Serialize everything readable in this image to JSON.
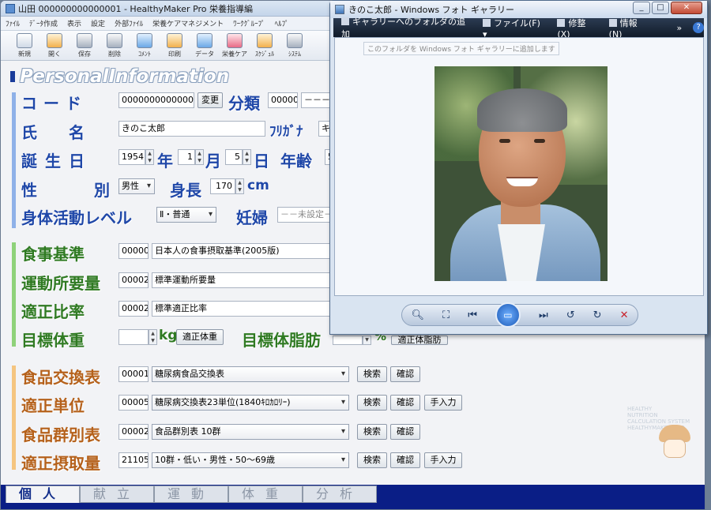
{
  "app": {
    "title": "山田 000000000000001 - HealthyMaker Pro 栄養指導編",
    "menu": [
      "ﾌｧｲﾙ",
      "ﾃﾞｰﾀ作成",
      "表示",
      "設定",
      "外部ﾌｧｲﾙ",
      "栄養ケアマネジメント",
      "ﾜｰｸｸﾞﾙｰﾌﾟ",
      "ﾍﾙﾌﾟ"
    ],
    "toolbar": [
      "新規",
      "開く",
      "保存",
      "削除",
      "ｺﾒﾝﾄ",
      "印刷",
      "データ",
      "栄養ケア",
      "ｽｹｼﾞｭﾙ",
      "ｼｽﾃﾑ"
    ],
    "section_title": "PersonalInformation"
  },
  "personal": {
    "code_label": "コード",
    "code_value": "000000000000001",
    "change_btn": "変更",
    "category_label": "分類",
    "category_code": "00000",
    "category_value": "－－－",
    "name_label": "氏　名",
    "name_value": "きのこ太郎",
    "furigana_label": "ﾌﾘｶﾞﾅ",
    "furigana_value": "キ",
    "birth_label": "誕生日",
    "birth_year": "1954",
    "year_unit": "年",
    "birth_month": "1",
    "month_unit": "月",
    "birth_day": "5",
    "day_unit": "日",
    "age_label": "年齢",
    "age_value": "5",
    "sex_label": "性　別",
    "sex_value": "男性",
    "height_label": "身長",
    "height_value": "170",
    "height_unit": "cm",
    "activity_label": "身体活動レベル",
    "activity_value": "Ⅱ・普通",
    "pregnancy_label": "妊婦",
    "pregnancy_value": "－－未設定－"
  },
  "diet": {
    "meal_label": "食事基準",
    "meal_code": "00000",
    "meal_value": "日本人の食事摂取基準(2005版)",
    "exercise_label": "運動所要量",
    "exercise_code": "00002",
    "exercise_value": "標準運動所要量",
    "ratio_label": "適正比率",
    "ratio_code": "00002",
    "ratio_value": "標準適正比率",
    "weight_label": "目標体重",
    "weight_unit": "kg",
    "weight_btn": "適正体重",
    "fat_label": "目標体脂肪",
    "fat_unit": "%",
    "fat_btn": "適正体脂肪"
  },
  "food": {
    "exchange_label": "食品交換表",
    "exchange_code": "00001",
    "exchange_value": "糖尿病食品交換表",
    "unit_label": "適正単位",
    "unit_code": "00005",
    "unit_value": "糖尿病交換表23単位(1840ｷﾛｶﾛﾘｰ)",
    "group_label": "食品群別表",
    "group_code": "00002",
    "group_value": "食品群別表 10群",
    "intake_label": "適正摂取量",
    "intake_code": "21105",
    "intake_value": "10群・低い・男性・50～69歳",
    "search_btn": "検索",
    "confirm_btn": "確認",
    "manual_btn": "手入力"
  },
  "tabs": [
    "個人",
    "献立",
    "運動",
    "体重",
    "分析"
  ],
  "logo_text": [
    "HEALTHY",
    "NUTRITION",
    "CALCULATION SYSTEM",
    "HEALTHYMAKER PRO"
  ],
  "gallery": {
    "title": "きのこ太郎 - Windows フォト ギャラリー",
    "menu_add": "ギャラリーへのフォルダの追加",
    "menu_file": "ファイル(F)",
    "menu_fix": "修整(X)",
    "menu_info": "情報(N)",
    "tooltip": "このフォルダを Windows フォト ギャラリーに追加します"
  }
}
